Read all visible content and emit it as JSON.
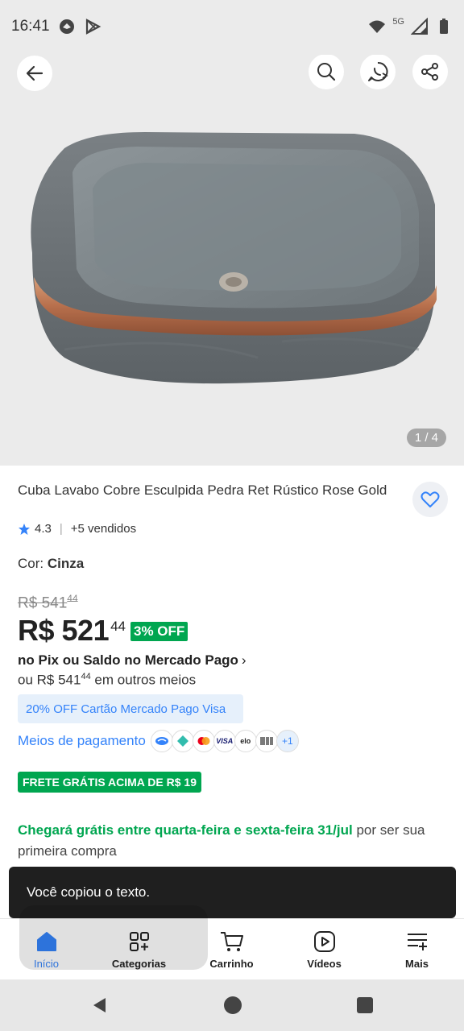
{
  "status": {
    "time": "16:41",
    "network": "5G"
  },
  "gallery": {
    "counter": "1 / 4"
  },
  "product": {
    "title": "Cuba Lavabo Cobre Esculpida Pedra Ret Rústico Rose Gold",
    "rating": "4.3",
    "sold": "+5 vendidos",
    "color_label": "Cor:",
    "color_value": "Cinza",
    "old_price": "R$ 541",
    "old_price_cents": "44",
    "price": "R$ 521",
    "price_cents": "44",
    "discount": "3% OFF",
    "pix_text": "no Pix ou Saldo no Mercado Pago",
    "other_prefix": "ou R$ 541",
    "other_cents": "44",
    "other_suffix": " em outros meios",
    "card_offer": "20% OFF Cartão Mercado Pago Visa",
    "payments_link": "Meios de pagamento",
    "payments_more": "+1",
    "free_shipping": "FRETE GRÁTIS ACIMA DE R$ 19",
    "delivery_green": "Chegará grátis entre quarta-feira e sexta-feira 31/jul",
    "delivery_rest": " por ser sua primeira compra"
  },
  "toast": {
    "text": "Você copiou o texto."
  },
  "nav": {
    "home": "Início",
    "categories": "Categorias",
    "cart": "Carrinho",
    "videos": "Vídeos",
    "more": "Mais"
  },
  "colors": {
    "accent": "#3483fa",
    "green": "#00a650"
  }
}
